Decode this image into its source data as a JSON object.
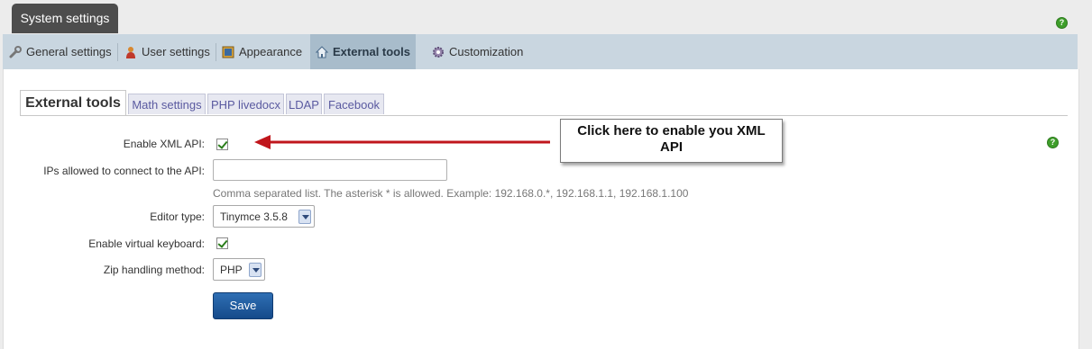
{
  "window": {
    "title": "System settings"
  },
  "topnav": {
    "items": [
      {
        "label": "General settings",
        "icon": "wrench-icon"
      },
      {
        "label": "User settings",
        "icon": "user-icon"
      },
      {
        "label": "Appearance",
        "icon": "picture-frame-icon"
      },
      {
        "label": "External tools",
        "icon": "home-icon",
        "active": true
      },
      {
        "label": "Customization",
        "icon": "gear-icon"
      }
    ]
  },
  "subtabs": [
    {
      "label": "External tools",
      "active": true
    },
    {
      "label": "Math settings"
    },
    {
      "label": "PHP livedocx"
    },
    {
      "label": "LDAP"
    },
    {
      "label": "Facebook"
    }
  ],
  "form": {
    "enable_xml_api": {
      "label": "Enable XML API:",
      "checked": true
    },
    "ips_allowed": {
      "label": "IPs allowed to connect to the API:",
      "value": "",
      "hint": "Comma separated list. The asterisk * is allowed. Example: 192.168.0.*, 192.168.1.1, 192.168.1.100"
    },
    "editor_type": {
      "label": "Editor type:",
      "value": "Tinymce 3.5.8"
    },
    "virtual_keyboard": {
      "label": "Enable virtual keyboard:",
      "checked": true
    },
    "zip_method": {
      "label": "Zip handling method:",
      "value": "PHP"
    },
    "save_label": "Save"
  },
  "annotation": {
    "text": "Click here to enable you XML API",
    "arrow_color": "#c0161c"
  },
  "colors": {
    "title_tab": "#4d4d4d",
    "nav_bg": "#c9d6e0",
    "nav_active": "#a8bccb",
    "save_button": "#1f5a9e",
    "help_icon": "#3e9e2a"
  }
}
